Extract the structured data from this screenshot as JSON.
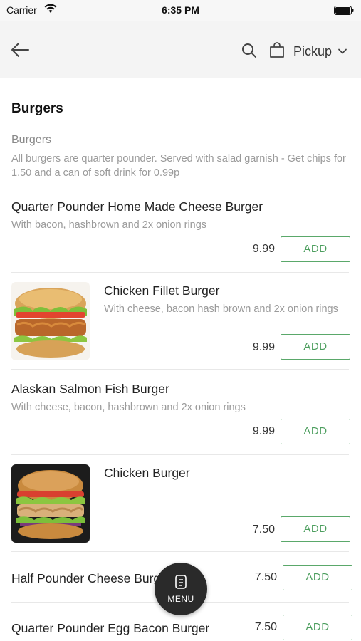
{
  "status_bar": {
    "carrier": "Carrier",
    "time": "6:35 PM"
  },
  "nav": {
    "order_mode": "Pickup",
    "back_icon": "back-arrow-icon",
    "search_icon": "search-icon",
    "bag_icon": "shopping-bag-icon"
  },
  "section": {
    "title": "Burgers",
    "category_name": "Burgers",
    "category_description": "All burgers are quarter pounder. Served with salad garnish - Get chips for 1.50 and a can of soft drink for 0.99p"
  },
  "items": [
    {
      "name": "Quarter Pounder Home Made Cheese Burger",
      "description": "With bacon, hashbrown and 2x onion rings",
      "price": "9.99",
      "button": "ADD"
    },
    {
      "name": "Chicken Fillet Burger",
      "description": "With cheese, bacon hash brown and 2x onion rings",
      "price": "9.99",
      "button": "ADD"
    },
    {
      "name": "Alaskan Salmon Fish Burger",
      "description": "With cheese, bacon, hashbrown and 2x onion rings",
      "price": "9.99",
      "button": "ADD"
    },
    {
      "name": "Chicken Burger",
      "description": "",
      "price": "7.50",
      "button": "ADD"
    },
    {
      "name": "Half Pounder Cheese Burger",
      "description": "",
      "price": "7.50",
      "button": "ADD"
    },
    {
      "name": "Quarter Pounder Egg Bacon Burger",
      "description": "",
      "price": "7.50",
      "button": "ADD"
    }
  ],
  "fab": {
    "label": "MENU",
    "icon": "menu-card-icon"
  },
  "colors": {
    "accent": "#4c9e5e",
    "nav_bg": "#f4f4f4",
    "fab_bg": "#2a2a2a"
  }
}
